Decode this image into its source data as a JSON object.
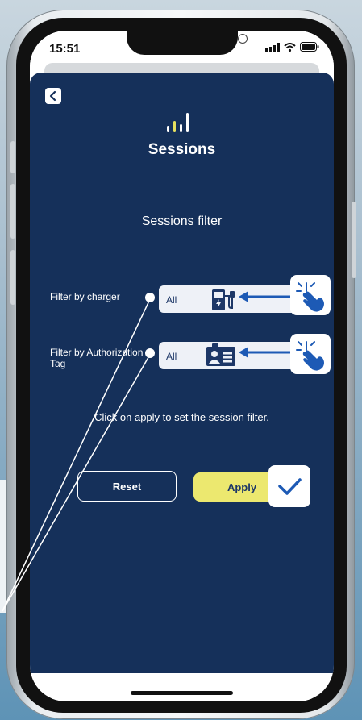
{
  "status_bar": {
    "time": "15:51"
  },
  "modal": {
    "title": "Sessions",
    "subtitle": "Sessions filter",
    "filters": [
      {
        "label": "Filter by charger",
        "value": "All",
        "icon": "charger-icon"
      },
      {
        "label": "Filter by Authorization Tag",
        "value": "All",
        "icon": "id-card-icon"
      }
    ],
    "help_text": "Click on apply to set the session filter.",
    "reset_label": "Reset",
    "apply_label": "Apply"
  },
  "colors": {
    "modal_bg": "#15305a",
    "accent_yellow": "#ece86f",
    "primary_blue": "#1d3767",
    "logo_yellow": "#e6e05f"
  },
  "icons": [
    "back-chevron-icon",
    "sessions-logo-icon",
    "charger-icon",
    "id-card-icon",
    "tap-hand-icon",
    "checkmark-icon",
    "signal-icon",
    "wifi-icon",
    "battery-icon"
  ]
}
